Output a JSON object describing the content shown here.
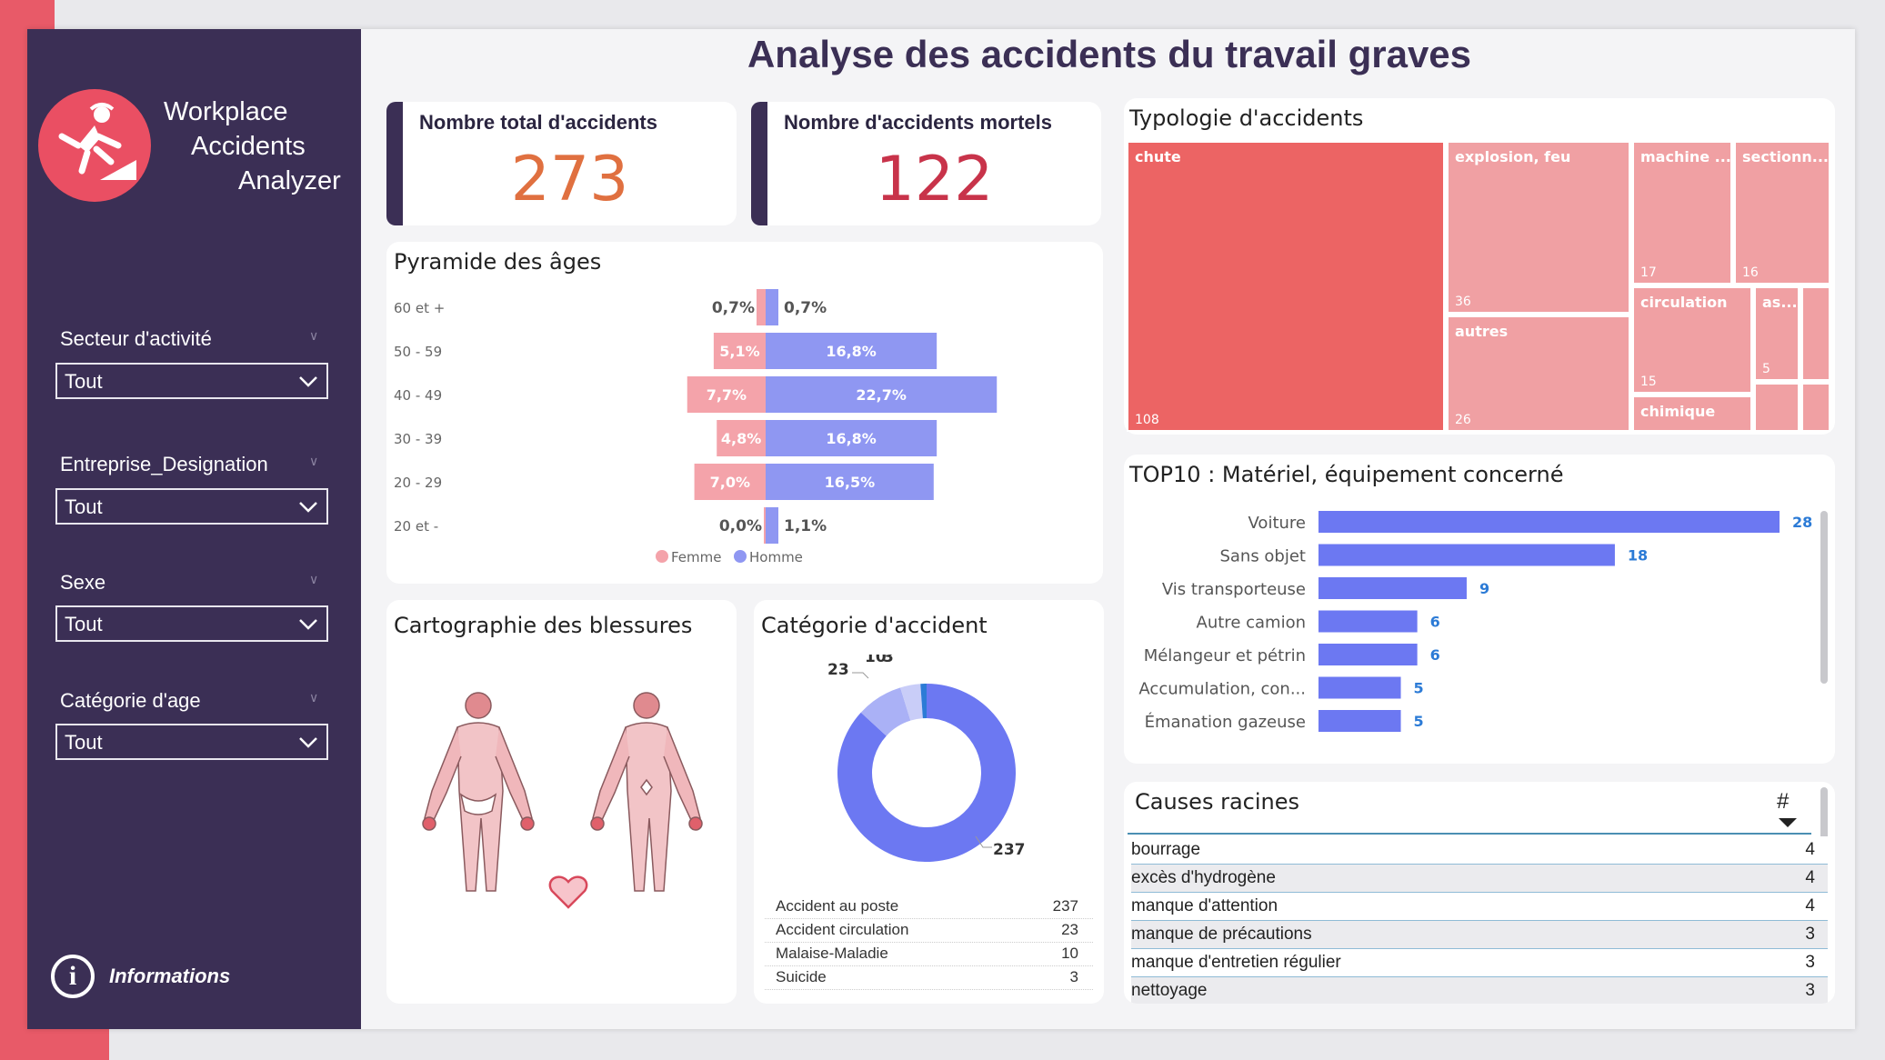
{
  "title": "Analyse des accidents du travail graves",
  "brand": {
    "lines": [
      "Workplace",
      "Accidents",
      "Analyzer"
    ],
    "colors": {
      "sidebar": "#3b2f55",
      "accent": "#ea4f63",
      "female": "#f4a3aa",
      "male": "#8f97f2",
      "bar": "#6c78f2"
    }
  },
  "slicers": [
    {
      "label": "Secteur d'activité",
      "value": "Tout"
    },
    {
      "label": "Entreprise_Designation",
      "value": "Tout"
    },
    {
      "label": "Sexe",
      "value": "Tout"
    },
    {
      "label": "Catégorie d'age",
      "value": "Tout"
    }
  ],
  "info": {
    "icon": "info-icon",
    "label": "Informations"
  },
  "kpis": [
    {
      "label": "Nombre total d'accidents",
      "value": "273",
      "color": "#e07040"
    },
    {
      "label": "Nombre d'accidents mortels",
      "value": "122",
      "color": "#c8334a"
    }
  ],
  "pyramid": {
    "title": "Pyramide des âges",
    "legend": {
      "female": "Femme",
      "male": "Homme"
    },
    "chart_data": {
      "type": "bar",
      "categories": [
        "60 et +",
        "50 - 59",
        "40 - 49",
        "30 - 39",
        "20 - 29",
        "20 et -"
      ],
      "series": [
        {
          "name": "Femme",
          "values": [
            0.7,
            5.1,
            7.7,
            4.8,
            7.0,
            0.0
          ],
          "labels": [
            "0,7%",
            "5,1%",
            "7,7%",
            "4,8%",
            "7,0%",
            "0,0%"
          ]
        },
        {
          "name": "Homme",
          "values": [
            0.7,
            16.8,
            22.7,
            16.8,
            16.5,
            1.1
          ],
          "labels": [
            "0,7%",
            "16,8%",
            "22,7%",
            "16,8%",
            "16,5%",
            "1,1%"
          ]
        }
      ]
    }
  },
  "treemap": {
    "title": "Typologie d'accidents",
    "chart_data": {
      "type": "treemap",
      "items": [
        {
          "label": "chute",
          "value": 108,
          "value_label": "108"
        },
        {
          "label": "explosion, feu",
          "value": 36,
          "value_label": "36"
        },
        {
          "label": "autres",
          "value": 26,
          "value_label": "26"
        },
        {
          "label": "machine ...",
          "value": 17,
          "value_label": "17"
        },
        {
          "label": "sectionn...",
          "value": 16,
          "value_label": "16"
        },
        {
          "label": "circulation",
          "value": 15,
          "value_label": "15"
        },
        {
          "label": "as...",
          "value": 5,
          "value_label": "5"
        },
        {
          "label": "chimique",
          "value": null,
          "value_label": ""
        }
      ]
    }
  },
  "top10": {
    "title": "TOP10 : Matériel, équipement concerné",
    "chart_data": {
      "type": "bar",
      "categories": [
        "Voiture",
        "Sans objet",
        "Vis transporteuse",
        "Autre camion",
        "Mélangeur et pétrin",
        "Accumulation, con...",
        "Émanation gazeuse"
      ],
      "values": [
        28,
        18,
        9,
        6,
        6,
        5,
        5
      ]
    }
  },
  "body_map": {
    "title": "Cartographie des blessures"
  },
  "donut": {
    "title": "Catégorie d'accident",
    "chart_data": {
      "type": "pie",
      "categories": [
        "Accident au poste",
        "Accident circulation",
        "Malaise-Maladie",
        "Suicide"
      ],
      "values": [
        237,
        23,
        10,
        3
      ]
    },
    "table": [
      {
        "label": "Accident au poste",
        "value": "237"
      },
      {
        "label": "Accident circulation",
        "value": "23"
      },
      {
        "label": "Malaise-Maladie",
        "value": "10"
      },
      {
        "label": "Suicide",
        "value": "3"
      }
    ]
  },
  "causes": {
    "title": "Causes racines",
    "col_header": "#",
    "rows": [
      {
        "label": "bourrage",
        "value": "4"
      },
      {
        "label": "excès d'hydrogène",
        "value": "4"
      },
      {
        "label": "manque d'attention",
        "value": "4"
      },
      {
        "label": "manque de précautions",
        "value": "3"
      },
      {
        "label": "manque d'entretien régulier",
        "value": "3"
      },
      {
        "label": "nettoyage",
        "value": "3"
      }
    ]
  }
}
